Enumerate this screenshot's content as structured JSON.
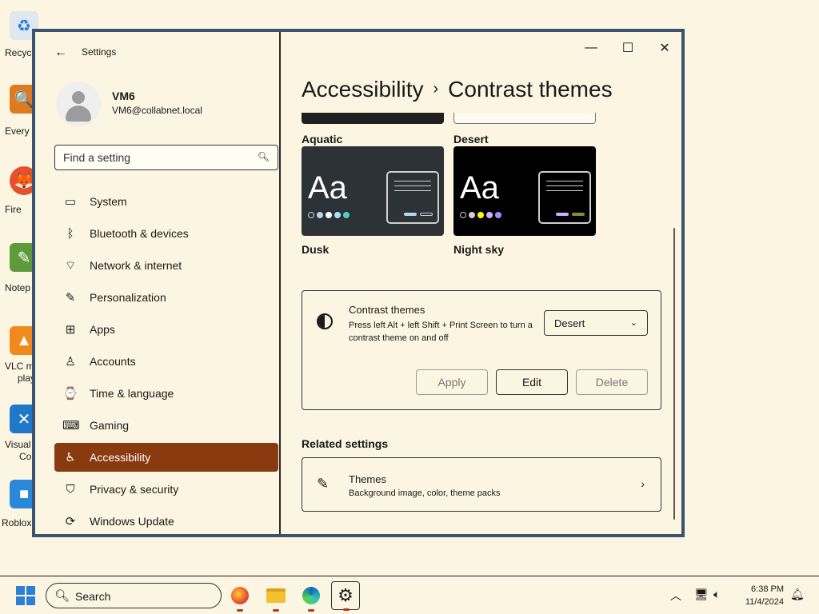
{
  "desktop": {
    "icons": [
      {
        "label": "Recyc",
        "icon": "recycle-bin-icon"
      },
      {
        "label": "Every",
        "icon": "everything-icon"
      },
      {
        "label": "Fire",
        "icon": "firefox-icon"
      },
      {
        "label": "Notep",
        "icon": "notepad-icon"
      },
      {
        "label": "VLC m",
        "label2": "play",
        "icon": "vlc-icon"
      },
      {
        "label": "Visual",
        "label2": "Co",
        "icon": "vscode-icon"
      },
      {
        "label": "Roblox",
        "icon": "roblox-icon"
      }
    ]
  },
  "window": {
    "app_title": "Settings",
    "controls": {
      "minimize": "—",
      "maximize": "☐",
      "close": "✕"
    }
  },
  "user": {
    "name": "VM6",
    "email": "VM6@collabnet.local"
  },
  "search": {
    "placeholder": "Find a setting"
  },
  "nav": {
    "items": [
      {
        "label": "System",
        "icon": "monitor-icon"
      },
      {
        "label": "Bluetooth & devices",
        "icon": "bluetooth-icon"
      },
      {
        "label": "Network & internet",
        "icon": "wifi-icon"
      },
      {
        "label": "Personalization",
        "icon": "brush-icon"
      },
      {
        "label": "Apps",
        "icon": "apps-icon"
      },
      {
        "label": "Accounts",
        "icon": "person-icon"
      },
      {
        "label": "Time & language",
        "icon": "time-language-icon"
      },
      {
        "label": "Gaming",
        "icon": "gamepad-icon"
      },
      {
        "label": "Accessibility",
        "icon": "accessibility-icon",
        "active": true
      },
      {
        "label": "Privacy & security",
        "icon": "shield-icon"
      },
      {
        "label": "Windows Update",
        "icon": "update-icon"
      }
    ]
  },
  "breadcrumb": {
    "parent": "Accessibility",
    "separator": "›",
    "current": "Contrast themes"
  },
  "themes": [
    {
      "name": "Aquatic",
      "bg": "#202020"
    },
    {
      "name": "Desert",
      "bg": "#fffaef"
    },
    {
      "name": "Dusk",
      "bg": "#2d3236",
      "aa": "Aa",
      "dots": [
        "#2d3236",
        "#b9d6f2",
        "#ffffff",
        "#a6e3ff",
        "#4fd1c5"
      ]
    },
    {
      "name": "Night sky",
      "bg": "#000000",
      "aa": "Aa",
      "dots": [
        "#000000",
        "#d0d0d0",
        "#ffff00",
        "#c8b3ff",
        "#a78bfa"
      ]
    }
  ],
  "contrast_panel": {
    "title": "Contrast themes",
    "description": "Press left Alt + left Shift + Print Screen to turn a contrast theme on and off",
    "selected": "Desert",
    "buttons": {
      "apply": "Apply",
      "edit": "Edit",
      "delete": "Delete"
    }
  },
  "related": {
    "title": "Related settings",
    "item_title": "Themes",
    "item_subtitle": "Background image, color, theme packs"
  },
  "taskbar": {
    "search_label": "Search",
    "time": "6:38 PM",
    "date": "11/4/2024"
  },
  "colors": {
    "accent": "#8a3a0f",
    "background": "#fbf5e2",
    "window_border": "#3b5371"
  }
}
